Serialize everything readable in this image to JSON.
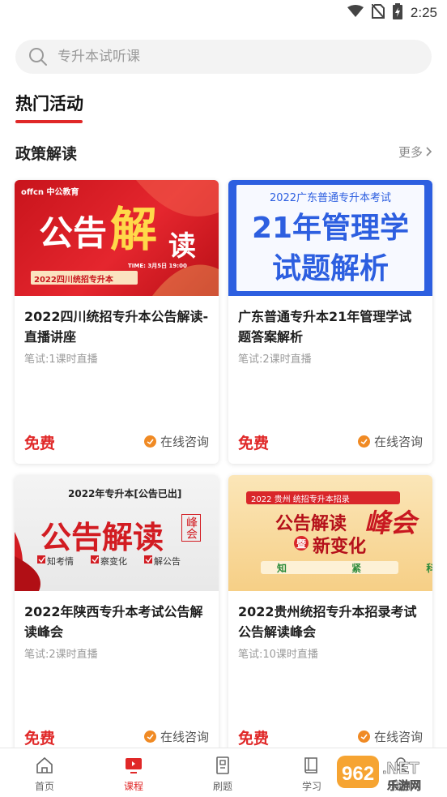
{
  "status_bar": {
    "time": "2:25",
    "icons": [
      "wifi-icon",
      "no-sim-icon",
      "battery-charging-icon"
    ]
  },
  "search": {
    "placeholder": "专升本试听课",
    "icon": "search-icon"
  },
  "section": {
    "title": "热门活动"
  },
  "policy": {
    "title": "政策解读",
    "more_label": "更多"
  },
  "cards": [
    {
      "banner": {
        "brand": "offcn 中公教育",
        "big1": "公告",
        "big2": "解",
        "big3": "读",
        "time": "TIME: 3月5日 19:00",
        "tag": "2022四川统招专升本"
      },
      "title": "2022四川统招专升本公告解读-直播讲座",
      "meta": "笔试:1课时直播",
      "price": "免费",
      "consult": "在线咨询"
    },
    {
      "banner": {
        "top": "2022广东普通专升本考试",
        "line1": "21年管理学",
        "line2": "试题解析"
      },
      "title": "广东普通专升本21年管理学试题答案解析",
      "meta": "笔试:2课时直播",
      "price": "免费",
      "consult": "在线咨询"
    },
    {
      "banner": {
        "top": "2022年专升本[公告已出]",
        "big": "公告解读",
        "side": "峰会",
        "chk1": "知考情",
        "chk2": "察变化",
        "chk3": "解公告"
      },
      "title": "2022年陕西专升本考试公告解读峰会",
      "meta": "笔试:2课时直播",
      "price": "免费",
      "consult": "在线咨询"
    },
    {
      "banner": {
        "top": "2022 贵州 统招专升本招录",
        "big": "公告解读",
        "side": "峰会",
        "sub": "新变化",
        "pre": "暨",
        "tags": "知 紧 科"
      },
      "title": "2022贵州统招专升本招录考试公告解读峰会",
      "meta": "笔试:10课时直播",
      "price": "免费",
      "consult": "在线咨询"
    }
  ],
  "tabs": [
    {
      "label": "首页",
      "icon": "home-icon",
      "active": false
    },
    {
      "label": "课程",
      "icon": "course-icon",
      "active": true
    },
    {
      "label": "刷题",
      "icon": "practice-icon",
      "active": false
    },
    {
      "label": "学习",
      "icon": "book-icon",
      "active": false
    },
    {
      "label": "我的",
      "icon": "profile-icon",
      "active": false
    }
  ],
  "watermark": {
    "line1": "962.NET",
    "line2": "乐游网"
  },
  "colors": {
    "accent": "#e02828",
    "consult": "#f08a24",
    "search_bg": "#f3f3f3"
  }
}
